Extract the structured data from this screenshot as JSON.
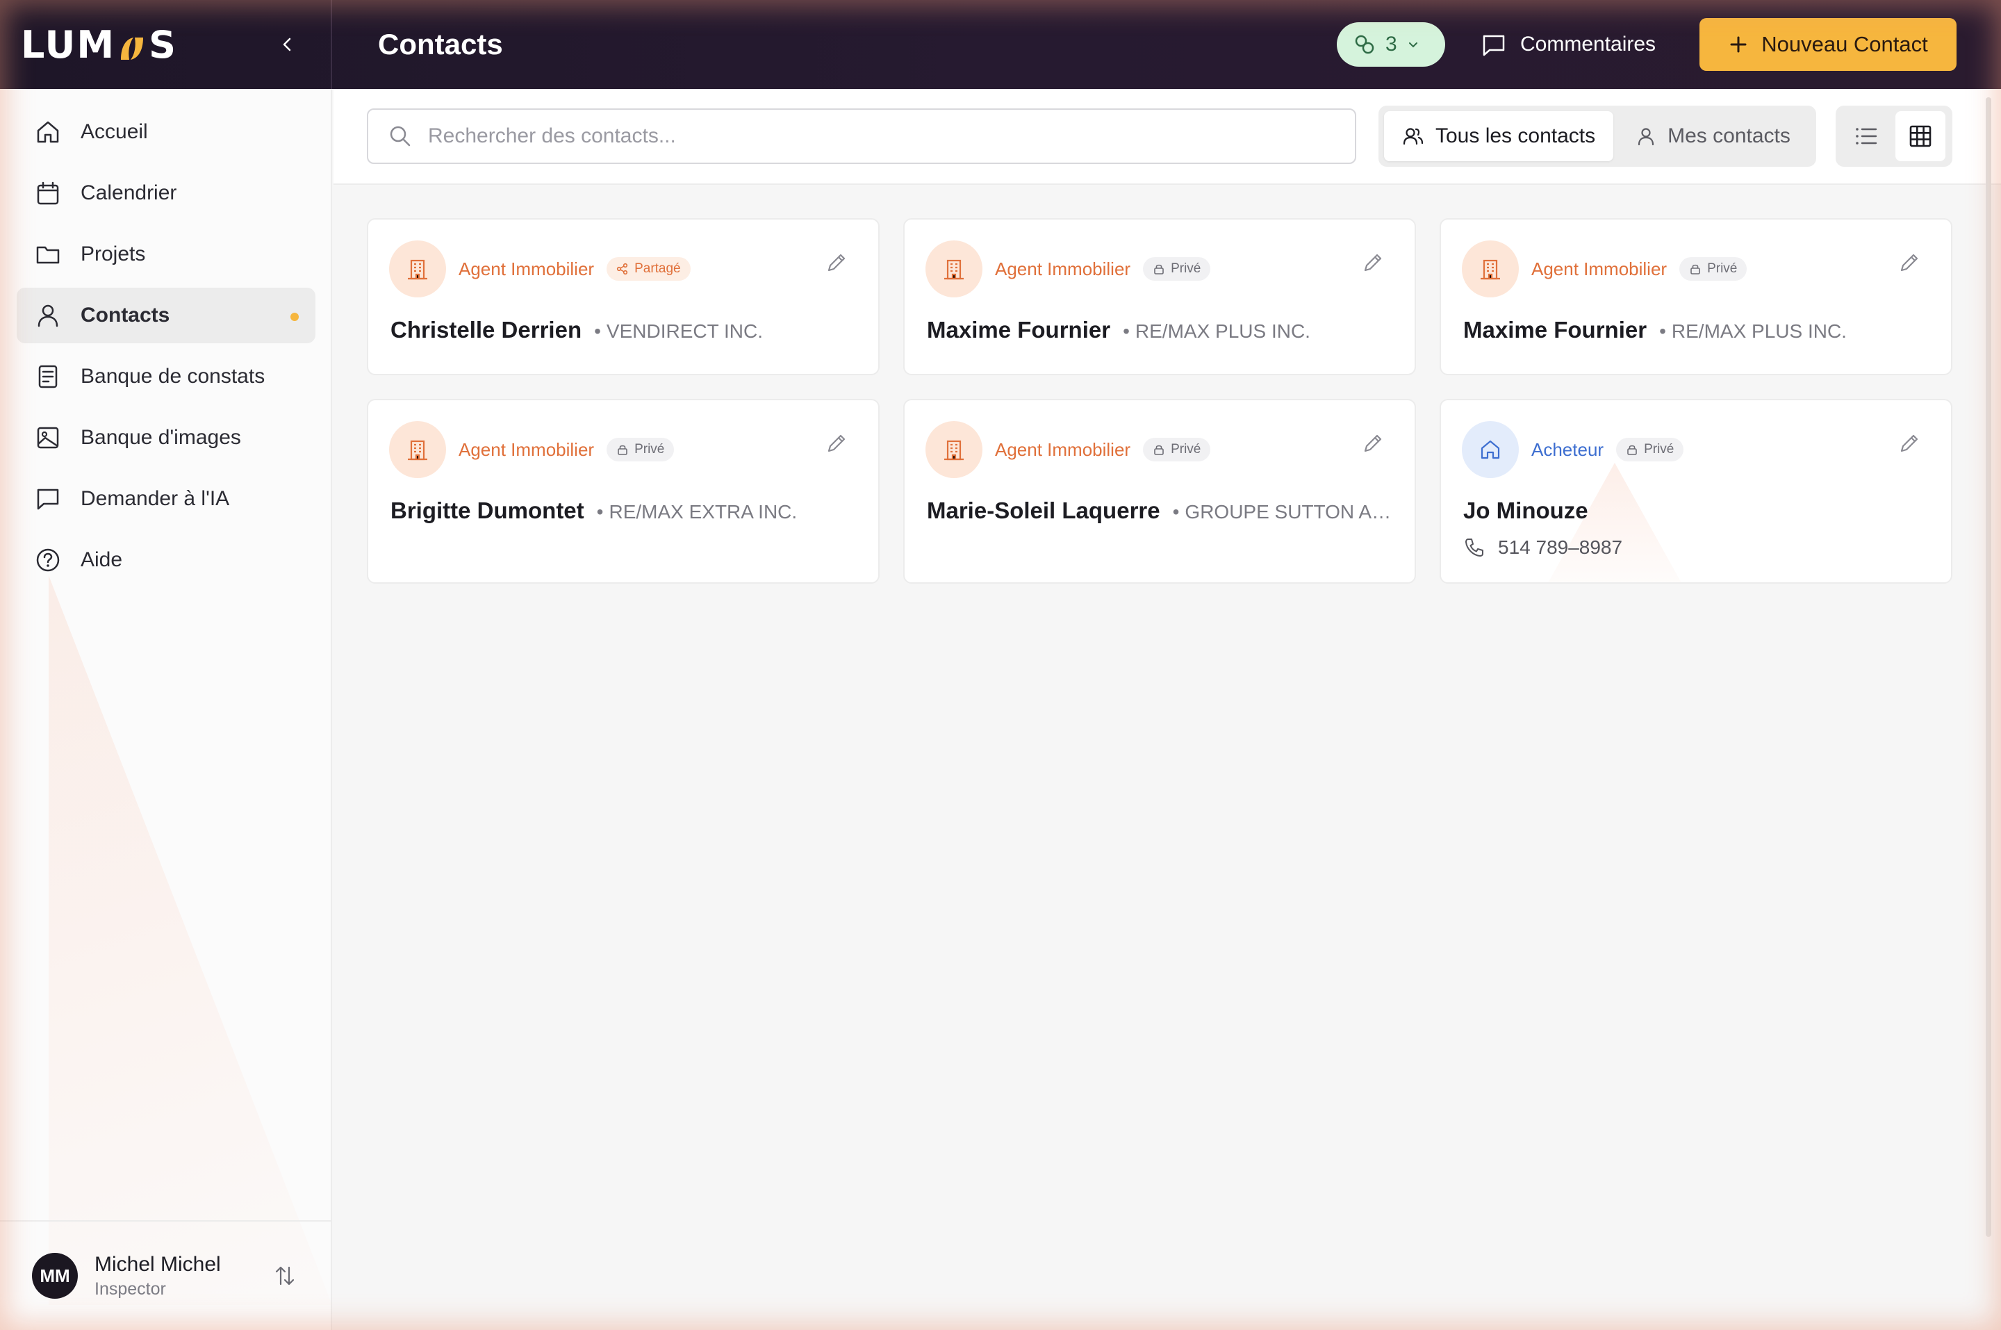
{
  "brand": {
    "logo_text_left": "LUM",
    "logo_text_right": "S"
  },
  "header": {
    "title": "Contacts",
    "counter_value": "3",
    "comments_label": "Commentaires",
    "new_contact_label": "Nouveau Contact"
  },
  "sidebar": {
    "items": [
      {
        "label": "Accueil",
        "icon": "home-icon"
      },
      {
        "label": "Calendrier",
        "icon": "calendar-icon"
      },
      {
        "label": "Projets",
        "icon": "folder-icon"
      },
      {
        "label": "Contacts",
        "icon": "user-icon",
        "active": true
      },
      {
        "label": "Banque de constats",
        "icon": "document-icon"
      },
      {
        "label": "Banque d'images",
        "icon": "image-icon"
      },
      {
        "label": "Demander à l'IA",
        "icon": "chat-icon"
      },
      {
        "label": "Aide",
        "icon": "help-icon"
      }
    ],
    "user": {
      "initials": "MM",
      "name": "Michel Michel",
      "role": "Inspector"
    }
  },
  "toolbar": {
    "search_placeholder": "Rechercher des contacts...",
    "filter_all": "Tous les contacts",
    "filter_mine": "Mes contacts",
    "selected_view": "grid"
  },
  "contacts": [
    {
      "role": "Agent Immobilier",
      "visibility": "Partagé",
      "name": "Christelle Derrien",
      "company": "VENDIRECT INC."
    },
    {
      "role": "Agent Immobilier",
      "visibility": "Privé",
      "name": "Maxime Fournier",
      "company": "RE/MAX PLUS INC."
    },
    {
      "role": "Agent Immobilier",
      "visibility": "Privé",
      "name": "Maxime Fournier",
      "company": "RE/MAX PLUS INC."
    },
    {
      "role": "Agent Immobilier",
      "visibility": "Privé",
      "name": "Brigitte Dumontet",
      "company": "RE/MAX EXTRA INC."
    },
    {
      "role": "Agent Immobilier",
      "visibility": "Privé",
      "name": "Marie-Soleil Laquerre",
      "company": "GROUPE SUTTON AC..."
    },
    {
      "role": "Acheteur",
      "visibility": "Privé",
      "name": "Jo Minouze",
      "phone": "514 789–8987"
    }
  ],
  "colors": {
    "accent": "#f6b63e",
    "agent": "#e0703a",
    "buyer": "#3d6ed0",
    "header_bg": "#1e1628"
  }
}
